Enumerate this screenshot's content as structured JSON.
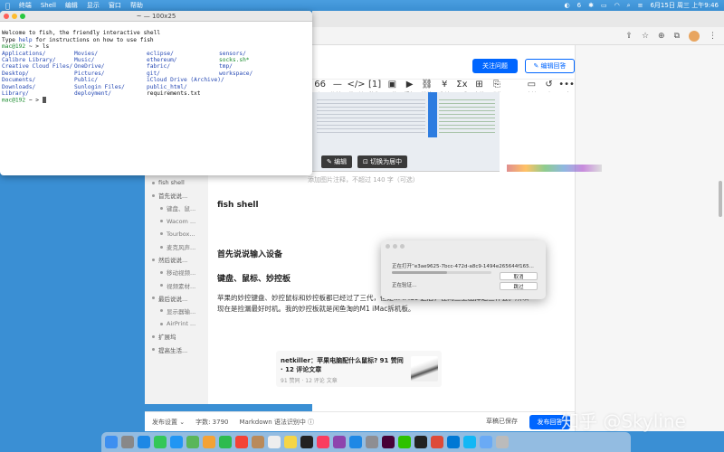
{
  "menubar": {
    "items": [
      "终端",
      "Shell",
      "编辑",
      "显示",
      "窗口",
      "帮助"
    ],
    "status_count": "6",
    "datetime": "6月15日 周三 上午9:46"
  },
  "terminal": {
    "title": "~ — 100x25",
    "welcome_1": "Welcome to fish, the friendly interactive shell",
    "welcome_2_prefix": "Type ",
    "welcome_2_help": "help",
    "welcome_2_suffix": " for instructions on how to use fish",
    "prompt_user": "mac@192",
    "prompt_path": "~",
    "prompt_symbol": ">",
    "command": "ls",
    "col1": [
      "Applications/",
      "Calibre Library/",
      "Creative Cloud Files/",
      "Desktop/",
      "Documents/",
      "Downloads/",
      "Library/"
    ],
    "col2": [
      "Movies/",
      "Music/",
      "OneDrive/",
      "Pictures/",
      "Public/",
      "Sunlogin Files/",
      "deployment/"
    ],
    "col3": [
      "eclipse/",
      "ethereum/",
      "fabric/",
      "git/",
      "iCloud Drive (Archive)/",
      "public_html/",
      "requirements.txt"
    ],
    "col4": [
      "sensors/",
      "socks.sh*",
      "tmp/",
      "workspace/",
      "",
      "",
      ""
    ]
  },
  "zhihu": {
    "follow_btn": "关注问题",
    "edit_answer_btn": "✎ 编辑回答",
    "toolbar": [
      {
        "icon": "66",
        "label": "引用"
      },
      {
        "icon": "—",
        "label": "分割线"
      },
      {
        "icon": "</>",
        "label": "代码块"
      },
      {
        "icon": "[1]",
        "label": "注释"
      },
      {
        "icon": "▣",
        "label": "图片"
      },
      {
        "icon": "▶",
        "label": "视频"
      },
      {
        "icon": "⛓",
        "label": "链接"
      },
      {
        "icon": "¥",
        "label": "收益"
      },
      {
        "icon": "Σx",
        "label": "公式"
      },
      {
        "icon": "⊞",
        "label": "表格"
      },
      {
        "icon": "⎘",
        "label": "附件"
      },
      {
        "icon": "",
        "label": ""
      },
      {
        "icon": "▭",
        "label": "文档"
      },
      {
        "icon": "↺",
        "label": "历史版本"
      },
      {
        "icon": "•••",
        "label": "更多▾"
      }
    ],
    "image_edit": "✎ 编辑",
    "image_center": "⊡ 切换为居中",
    "caption": "添加图片注释，不超过 140 字（可选）",
    "h_fish": "fish shell",
    "h_input": "首先说说输入设备",
    "h_kbd": "键盘、鼠标、妙控板",
    "para": "苹果的妙控键盘、妙控鼠标和妙控板都已经过了三代，但是... iMac 之后，在闲鱼上出掉这三件套。所以现在是捡漏最好时机。我的妙控板就是闲鱼淘的M1 iMac拆机板。",
    "card_title": "netkiller：苹果电脑配什么鼠标? 91 赞同 · 12 评论文章",
    "card_meta": "91 赞同 · 12 评论    文章",
    "outline": [
      {
        "label": "fish shell",
        "level": 1
      },
      {
        "label": "首先说说...",
        "level": 1
      },
      {
        "label": "键盘、鼠...",
        "level": 2
      },
      {
        "label": "Wacom ...",
        "level": 2
      },
      {
        "label": "Tourbox...",
        "level": 2
      },
      {
        "label": "麦克风声...",
        "level": 2
      },
      {
        "label": "然后说说...",
        "level": 1
      },
      {
        "label": "移动视频...",
        "level": 2
      },
      {
        "label": "视频素材...",
        "level": 2
      },
      {
        "label": "最后说说...",
        "level": 1
      },
      {
        "label": "显示器输...",
        "level": 2
      },
      {
        "label": "AirPrint ...",
        "level": 2
      },
      {
        "label": "扩展坞",
        "level": 1
      },
      {
        "label": "提高生活...",
        "level": 1
      }
    ],
    "bottom": {
      "settings": "发布设置 ⌄",
      "wordcount": "字数: 3790",
      "markdown": "Markdown 语法识别中 ⓘ",
      "draft": "草稿已保存",
      "publish": "发布回答"
    },
    "watermark": "知乎 @Skyline"
  },
  "dialog": {
    "opening": "正在打开“e3ae9625-7bcc-472d-a8c9-1494e265644f165...",
    "verifying": "正在验证...",
    "progress": 0.55,
    "cancel": "取消",
    "skip": "跳过"
  },
  "dock": {
    "apps": [
      {
        "name": "finder",
        "color": "#3d8ff0"
      },
      {
        "name": "launchpad",
        "color": "#888"
      },
      {
        "name": "safari",
        "color": "#1e88e5"
      },
      {
        "name": "messages",
        "color": "#34c759"
      },
      {
        "name": "mail",
        "color": "#2196f3"
      },
      {
        "name": "maps",
        "color": "#5ab65a"
      },
      {
        "name": "photos",
        "color": "#f4a236"
      },
      {
        "name": "facetime",
        "color": "#2dbb4f"
      },
      {
        "name": "calendar",
        "color": "#f44336"
      },
      {
        "name": "contacts",
        "color": "#b98a5a"
      },
      {
        "name": "reminders",
        "color": "#eeeeee"
      },
      {
        "name": "notes",
        "color": "#f5d547"
      },
      {
        "name": "tv",
        "color": "#222"
      },
      {
        "name": "music",
        "color": "#fa3d5f"
      },
      {
        "name": "podcasts",
        "color": "#8e44ad"
      },
      {
        "name": "appstore",
        "color": "#1e88e5"
      },
      {
        "name": "settings",
        "color": "#8e8e93"
      },
      {
        "name": "xd",
        "color": "#470137"
      },
      {
        "name": "wechat",
        "color": "#2dc100"
      },
      {
        "name": "terminal",
        "color": "#222"
      },
      {
        "name": "chrome",
        "color": "#dd4b39"
      },
      {
        "name": "vscode",
        "color": "#0078d4"
      },
      {
        "name": "qq",
        "color": "#12b7f5"
      },
      {
        "name": "folder",
        "color": "#6aaaf5"
      },
      {
        "name": "trash",
        "color": "#bbb"
      }
    ]
  }
}
